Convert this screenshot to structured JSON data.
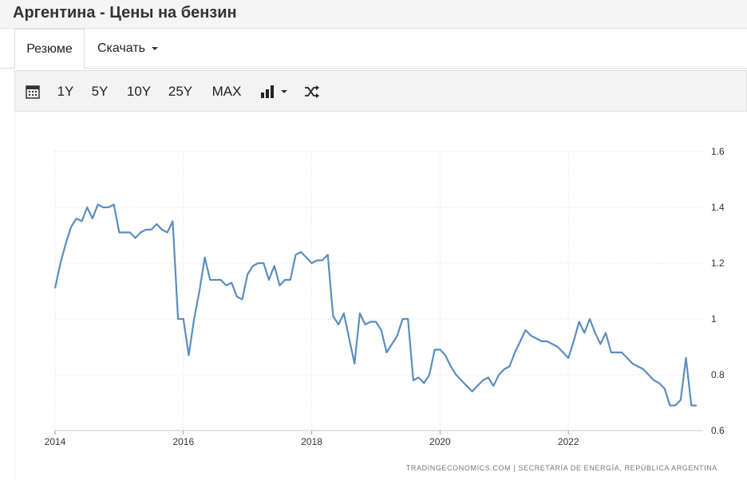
{
  "header": {
    "title": "Аргентина - Цены на бензин"
  },
  "tabs": [
    {
      "label": "Резюме"
    },
    {
      "label": "Скачать"
    }
  ],
  "toolbar": {
    "ranges": [
      "1Y",
      "5Y",
      "10Y",
      "25Y",
      "MAX"
    ],
    "icons": [
      "calendar-icon",
      "bar-chart-icon",
      "shuffle-icon"
    ]
  },
  "chart_data": {
    "type": "line",
    "title": "",
    "xlabel": "",
    "ylabel": "",
    "x_ticks": [
      "2014",
      "2016",
      "2018",
      "2020",
      "2022"
    ],
    "y_ticks": [
      "0.6",
      "0.8",
      "1",
      "1.2",
      "1.4",
      "1.6"
    ],
    "xlim": [
      2014,
      2024.1
    ],
    "ylim": [
      0.6,
      1.6
    ],
    "grid": true,
    "line_color": "#5b8dc0",
    "source_text": "TRADINGECONOMICS.COM  |  SECRETARÍA DE ENERGÍA, REPÚBLICA ARGENTINA",
    "series": [
      {
        "x": [
          2014.0,
          2014.083,
          2014.167,
          2014.25,
          2014.333,
          2014.417,
          2014.5,
          2014.583,
          2014.667,
          2014.75,
          2014.833,
          2014.917,
          2015.0,
          2015.083,
          2015.167,
          2015.25,
          2015.333,
          2015.417,
          2015.5,
          2015.583,
          2015.667,
          2015.75,
          2015.833,
          2015.917,
          2016.0,
          2016.083,
          2016.167,
          2016.25,
          2016.333,
          2016.417,
          2016.5,
          2016.583,
          2016.667,
          2016.75,
          2016.833,
          2016.917,
          2017.0,
          2017.083,
          2017.167,
          2017.25,
          2017.333,
          2017.417,
          2017.5,
          2017.583,
          2017.667,
          2017.75,
          2017.833,
          2017.917,
          2018.0,
          2018.083,
          2018.167,
          2018.25,
          2018.333,
          2018.417,
          2018.5,
          2018.583,
          2018.667,
          2018.75,
          2018.833,
          2018.917,
          2019.0,
          2019.083,
          2019.167,
          2019.25,
          2019.333,
          2019.417,
          2019.5,
          2019.583,
          2019.667,
          2019.75,
          2019.833,
          2019.917,
          2020.0,
          2020.083,
          2020.167,
          2020.25,
          2020.333,
          2020.417,
          2020.5,
          2020.583,
          2020.667,
          2020.75,
          2020.833,
          2020.917,
          2021.0,
          2021.083,
          2021.167,
          2021.25,
          2021.333,
          2021.417,
          2021.5,
          2021.583,
          2021.667,
          2021.75,
          2021.833,
          2021.917,
          2022.0,
          2022.083,
          2022.167,
          2022.25,
          2022.333,
          2022.417,
          2022.5,
          2022.583,
          2022.667,
          2022.75,
          2022.833,
          2022.917,
          2023.0,
          2023.083,
          2023.167,
          2023.25,
          2023.333,
          2023.417,
          2023.5,
          2023.583,
          2023.667,
          2023.75,
          2023.833,
          2023.917,
          2024.0
        ],
        "y": [
          1.11,
          1.2,
          1.27,
          1.33,
          1.36,
          1.35,
          1.4,
          1.36,
          1.41,
          1.4,
          1.4,
          1.41,
          1.31,
          1.31,
          1.31,
          1.29,
          1.31,
          1.32,
          1.32,
          1.34,
          1.32,
          1.31,
          1.35,
          1.0,
          1.0,
          0.87,
          1.0,
          1.1,
          1.22,
          1.14,
          1.14,
          1.14,
          1.12,
          1.13,
          1.08,
          1.07,
          1.16,
          1.19,
          1.2,
          1.2,
          1.14,
          1.19,
          1.12,
          1.14,
          1.14,
          1.23,
          1.24,
          1.22,
          1.2,
          1.21,
          1.21,
          1.23,
          1.01,
          0.98,
          1.02,
          0.93,
          0.84,
          1.02,
          0.98,
          0.99,
          0.99,
          0.96,
          0.88,
          0.91,
          0.94,
          1.0,
          1.0,
          0.78,
          0.79,
          0.77,
          0.8,
          0.89,
          0.89,
          0.87,
          0.83,
          0.8,
          0.78,
          0.76,
          0.74,
          0.76,
          0.78,
          0.79,
          0.76,
          0.8,
          0.82,
          0.83,
          0.88,
          0.92,
          0.96,
          0.94,
          0.93,
          0.92,
          0.92,
          0.91,
          0.9,
          0.88,
          0.86,
          0.92,
          0.99,
          0.95,
          1.0,
          0.95,
          0.91,
          0.95,
          0.88,
          0.88,
          0.88,
          0.86,
          0.84,
          0.83,
          0.82,
          0.8,
          0.78,
          0.77,
          0.75,
          0.69,
          0.69,
          0.71,
          0.86,
          0.69,
          0.69
        ]
      }
    ]
  }
}
